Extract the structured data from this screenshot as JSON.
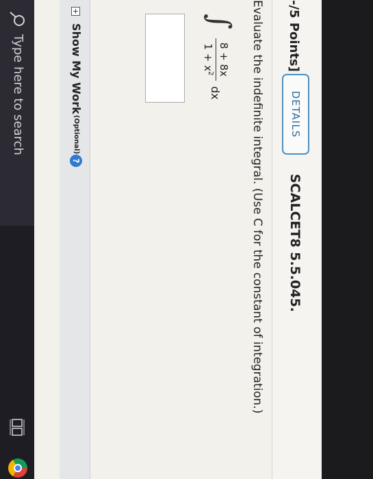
{
  "header": {
    "points": "-/5 Points]",
    "details_label": "DETAILS",
    "problem_id": "SCALCET8 5.5.045."
  },
  "problem": {
    "instructions": "Evaluate the indefinite integral. (Use C for the constant of integration.)",
    "integral_sign": "∫",
    "numerator": "8 + 8x",
    "denominator_base": "1 + x",
    "denominator_exp": "2",
    "differential": "dx"
  },
  "show_work": {
    "expand_glyph": "+",
    "label": "Show My Work",
    "optional": "(Optional)",
    "help_glyph": "?"
  },
  "taskbar": {
    "search_placeholder": "Type here to search",
    "icons": [
      "search-icon",
      "task-view-icon",
      "chrome-icon"
    ]
  },
  "colors": {
    "details_border": "#4a8fc4",
    "help_icon": "#2f7ad0",
    "taskbar": "#1e1d24"
  }
}
